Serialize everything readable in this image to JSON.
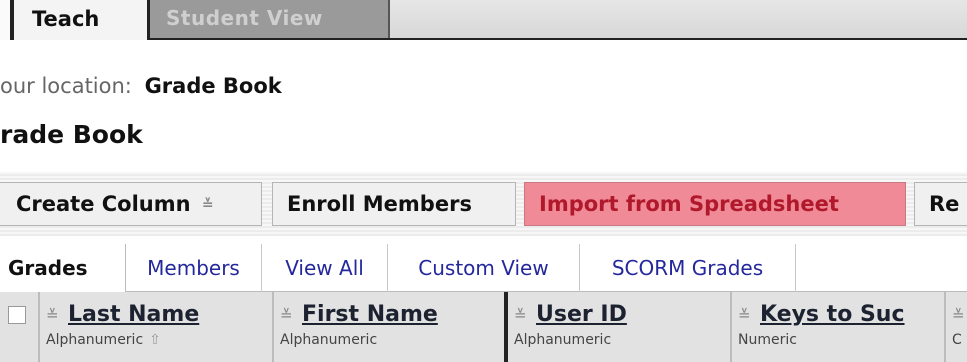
{
  "top_tabs": {
    "teach": "Teach",
    "student_view": "Student View"
  },
  "location": {
    "label": "our location:",
    "value": "Grade Book"
  },
  "page_title": "rade Book",
  "toolbar": {
    "create_column": "Create Column",
    "enroll_members": "Enroll Members",
    "import_spreadsheet": "Import from Spreadsheet",
    "re": "Re"
  },
  "content_tabs": [
    "Grades",
    "Members",
    "View All",
    "Custom View",
    "SCORM Grades"
  ],
  "columns": [
    {
      "name": "Last Name",
      "type": "Alphanumeric"
    },
    {
      "name": "First Name",
      "type": "Alphanumeric"
    },
    {
      "name": "User ID",
      "type": "Alphanumeric"
    },
    {
      "name": "Keys to Suc",
      "type": "Numeric"
    },
    {
      "name": "",
      "type": "C"
    }
  ],
  "colors": {
    "import_bg": "#f08a96",
    "import_text": "#b0182c",
    "tab_link": "#24289c"
  }
}
